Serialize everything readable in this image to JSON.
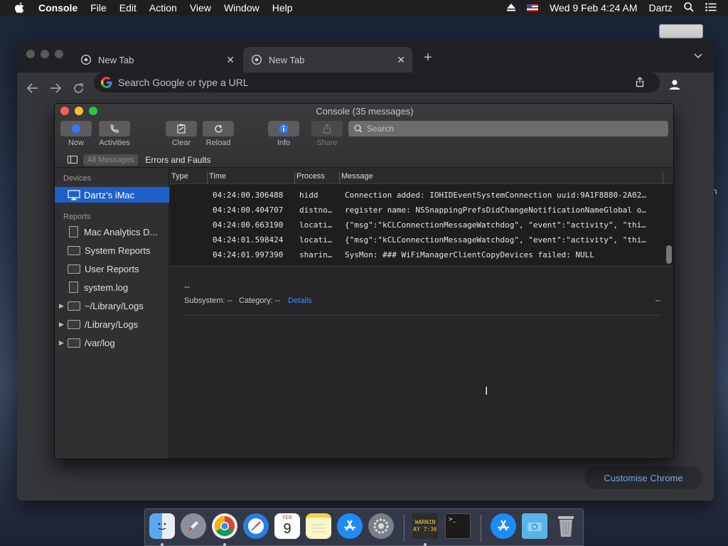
{
  "menubar": {
    "app_name": "Console",
    "items": [
      "File",
      "Edit",
      "Action",
      "View",
      "Window",
      "Help"
    ],
    "clock": "Wed 9 Feb  4:24 AM",
    "user": "Dartz"
  },
  "desktop": {
    "edge_label": "n"
  },
  "chrome": {
    "tabs": [
      {
        "title": "New Tab",
        "active": false
      },
      {
        "title": "New Tab",
        "active": true
      }
    ],
    "omnibox_placeholder": "Search Google or type a URL",
    "customise_label": "Customise Chrome"
  },
  "console": {
    "title": "Console (35 messages)",
    "toolbar": {
      "now_label": "Now",
      "activities_label": "Activities",
      "clear_label": "Clear",
      "reload_label": "Reload",
      "info_label": "Info",
      "share_label": "Share"
    },
    "search_placeholder": "Search",
    "filters": {
      "all_messages": "All Messages",
      "errors_faults": "Errors and Faults"
    },
    "sidebar": {
      "devices_header": "Devices",
      "device": "Dartz’s iMac",
      "reports_header": "Reports",
      "items": [
        {
          "label": "Mac Analytics D...",
          "icon": "document-icon",
          "disclosure": false
        },
        {
          "label": "System Reports",
          "icon": "folder-icon",
          "disclosure": false
        },
        {
          "label": "User Reports",
          "icon": "folder-icon",
          "disclosure": false
        },
        {
          "label": "system.log",
          "icon": "document-icon",
          "disclosure": false
        },
        {
          "label": "~/Library/Logs",
          "icon": "folder-icon",
          "disclosure": true
        },
        {
          "label": "/Library/Logs",
          "icon": "folder-icon",
          "disclosure": true
        },
        {
          "label": "/var/log",
          "icon": "folder-icon",
          "disclosure": true
        }
      ]
    },
    "columns": [
      "Type",
      "Time",
      "Process",
      "Message"
    ],
    "rows": [
      {
        "time": "04:24:00.306488",
        "process": "hidd",
        "message": "Connection added: IOHIDEventSystemConnection uuid:9A1F8880-2A02…"
      },
      {
        "time": "04:24:00.404707",
        "process": "distno…",
        "message": "register name: NSSnappingPrefsDidChangeNotificationNameGlobal o…"
      },
      {
        "time": "04:24:00.663190",
        "process": "locati…",
        "message": "{\"msg\":\"kCLConnectionMessageWatchdog\", \"event\":\"activity\", \"thi…"
      },
      {
        "time": "04:24:01.598424",
        "process": "locati…",
        "message": "{\"msg\":\"kCLConnectionMessageWatchdog\", \"event\":\"activity\", \"thi…"
      },
      {
        "time": "04:24:01.997390",
        "process": "sharin…",
        "message": "SysMon: ### WiFiManagerClientCopyDevices failed: NULL"
      }
    ],
    "detail": {
      "placeholder": "--",
      "subsystem_label": "Subsystem: --",
      "category_label": "Category: --",
      "details_link": "Details",
      "right_value": "--"
    }
  },
  "dock": {
    "apps": [
      "finder-icon",
      "launchpad-icon",
      "chrome-icon",
      "safari-icon",
      "calendar-icon",
      "notes-icon",
      "app-store-icon",
      "system-preferences-icon",
      "console-icon",
      "terminal-icon",
      "app-store-download-icon",
      "downloads-folder-icon",
      "trash-icon"
    ],
    "calendar_month": "FEB",
    "calendar_day": "9",
    "console_icon_text_1": "WARNIN",
    "console_icon_text_2": "AY 7:36"
  },
  "colors": {
    "selection_blue": "#1f5fc8",
    "link_blue": "#3b8dff",
    "chrome_link": "#8ab4f8"
  }
}
